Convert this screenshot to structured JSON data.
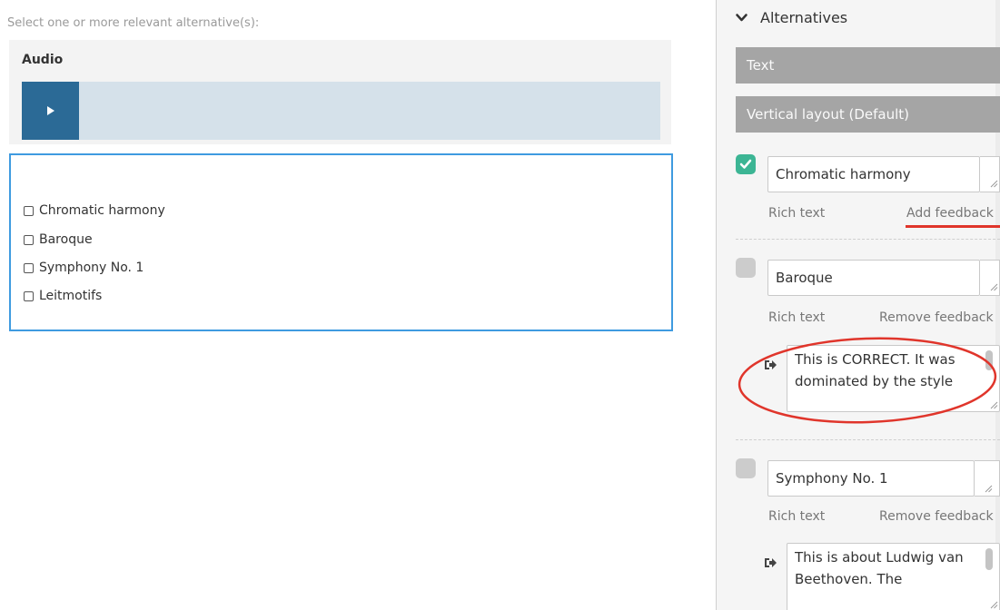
{
  "preview": {
    "instruction": "Select one or more relevant alternative(s):",
    "audio_title": "Audio",
    "options": [
      "Chromatic harmony",
      "Baroque",
      "Symphony No. 1",
      "Leitmotifs"
    ]
  },
  "editor": {
    "section_title": "Alternatives",
    "type_bar": "Text",
    "layout_bar": "Vertical layout (Default)",
    "alternatives": [
      {
        "value": "Chromatic harmony",
        "checked": true,
        "rich_text": "Rich text",
        "feedback_link": "Add feedback"
      },
      {
        "value": "Baroque",
        "checked": false,
        "rich_text": "Rich text",
        "feedback_link": "Remove feedback",
        "feedback_text": "This is CORRECT. It was dominated by the style"
      },
      {
        "value": "Symphony No. 1",
        "checked": false,
        "rich_text": "Rich text",
        "feedback_link": "Remove feedback",
        "feedback_text": "This is about Ludwig van Beethoven. The"
      }
    ]
  },
  "colors": {
    "play_button": "#2b6a96",
    "player_track": "#d5e1ea",
    "selected_outline": "#3f9be0",
    "checked_green": "#3cb594",
    "annotation_red": "#e0352b",
    "gray_bar": "#a5a5a5"
  }
}
